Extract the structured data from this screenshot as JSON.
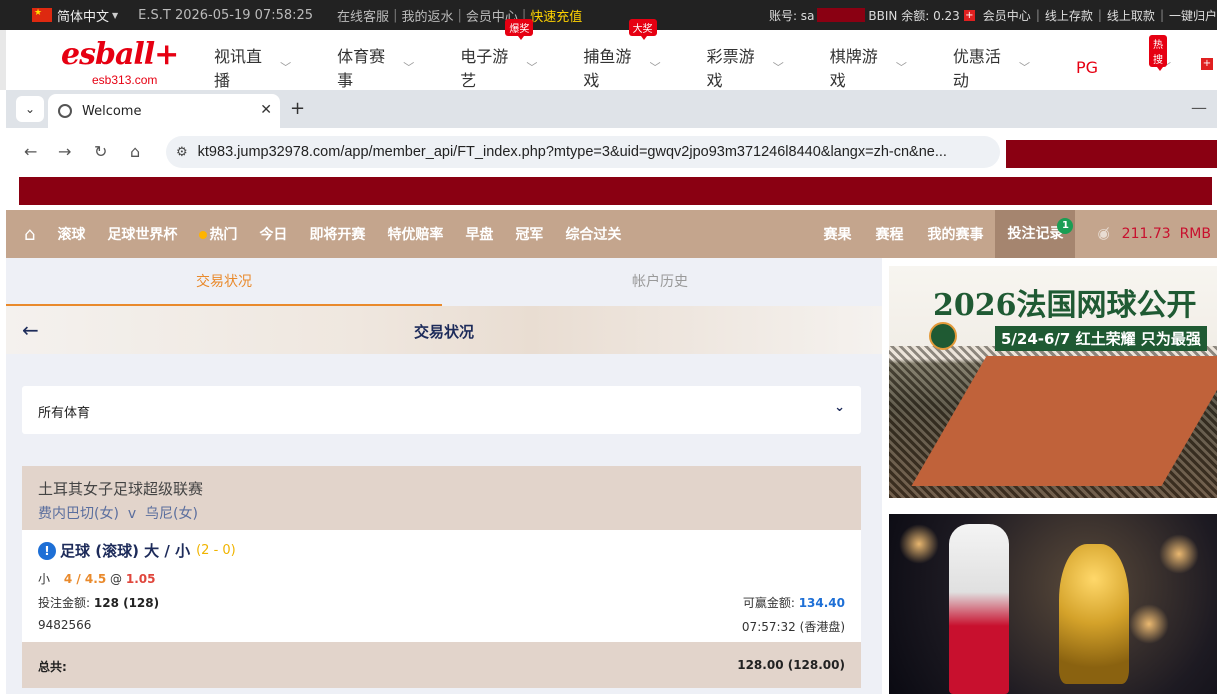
{
  "topbar": {
    "language": "简体中文",
    "est_time": "E.S.T 2026-05-19 07:58:25",
    "links": [
      "在线客服",
      "我的返水",
      "会员中心"
    ],
    "highlight_link": "快速充值",
    "account_label": "账号: sa",
    "bbin_balance": "BBIN 余额: 0.23",
    "right_links": [
      "会员中心",
      "线上存款",
      "线上取款",
      "一键归户"
    ]
  },
  "site": {
    "logo": "esball+",
    "logo_sub": "esb313.com",
    "nav": [
      {
        "label": "视讯直播",
        "badge": ""
      },
      {
        "label": "体育赛事",
        "badge": ""
      },
      {
        "label": "电子游艺",
        "badge": "爆奖"
      },
      {
        "label": "捕鱼游戏",
        "badge": "大奖"
      },
      {
        "label": "彩票游戏",
        "badge": ""
      },
      {
        "label": "棋牌游戏",
        "badge": ""
      },
      {
        "label": "优惠活动",
        "badge": ""
      }
    ],
    "pg_label": "PG",
    "hot_badge": "热搜"
  },
  "browser": {
    "tab_title": "Welcome",
    "url": "kt983.jump32978.com/app/member_api/FT_index.php?mtype=3&uid=gwqv2jpo93m371246l8440&langx=zh-cn&ne..."
  },
  "sportsnav": {
    "items": [
      "滚球",
      "足球世界杯",
      "热门",
      "今日",
      "即将开赛",
      "特优赔率",
      "早盘",
      "冠军",
      "综合过关"
    ],
    "right_items": [
      "赛果",
      "赛程",
      "我的赛事"
    ],
    "active": "投注记录",
    "active_count": "1",
    "balance": "211.73",
    "currency": "RMB"
  },
  "main": {
    "subtabs": [
      "交易状况",
      "帐户历史"
    ],
    "header_title": "交易状况",
    "select_value": "所有体育",
    "bet": {
      "league": "土耳其女子足球超级联赛",
      "home": "费内巴切(女)",
      "vs": "v",
      "away": "乌尼(女)",
      "market": "足球 (滚球) 大 / 小",
      "score": "(2 - 0)",
      "selection": "小",
      "handicap": "4 / 4.5",
      "at": "@",
      "odds": "1.05",
      "stake_label": "投注金额:",
      "stake_value": "128 (128)",
      "win_label": "可赢金额:",
      "win_value": "134.40",
      "ticket_id": "9482566",
      "time": "07:57:32 (香港盘)"
    },
    "total_label": "总共:",
    "total_value": "128.00 (128.00)"
  },
  "promos": {
    "promo1_title": "2026法国网球公开",
    "promo1_sub": "5/24-6/7 红土荣耀 只为最强"
  }
}
